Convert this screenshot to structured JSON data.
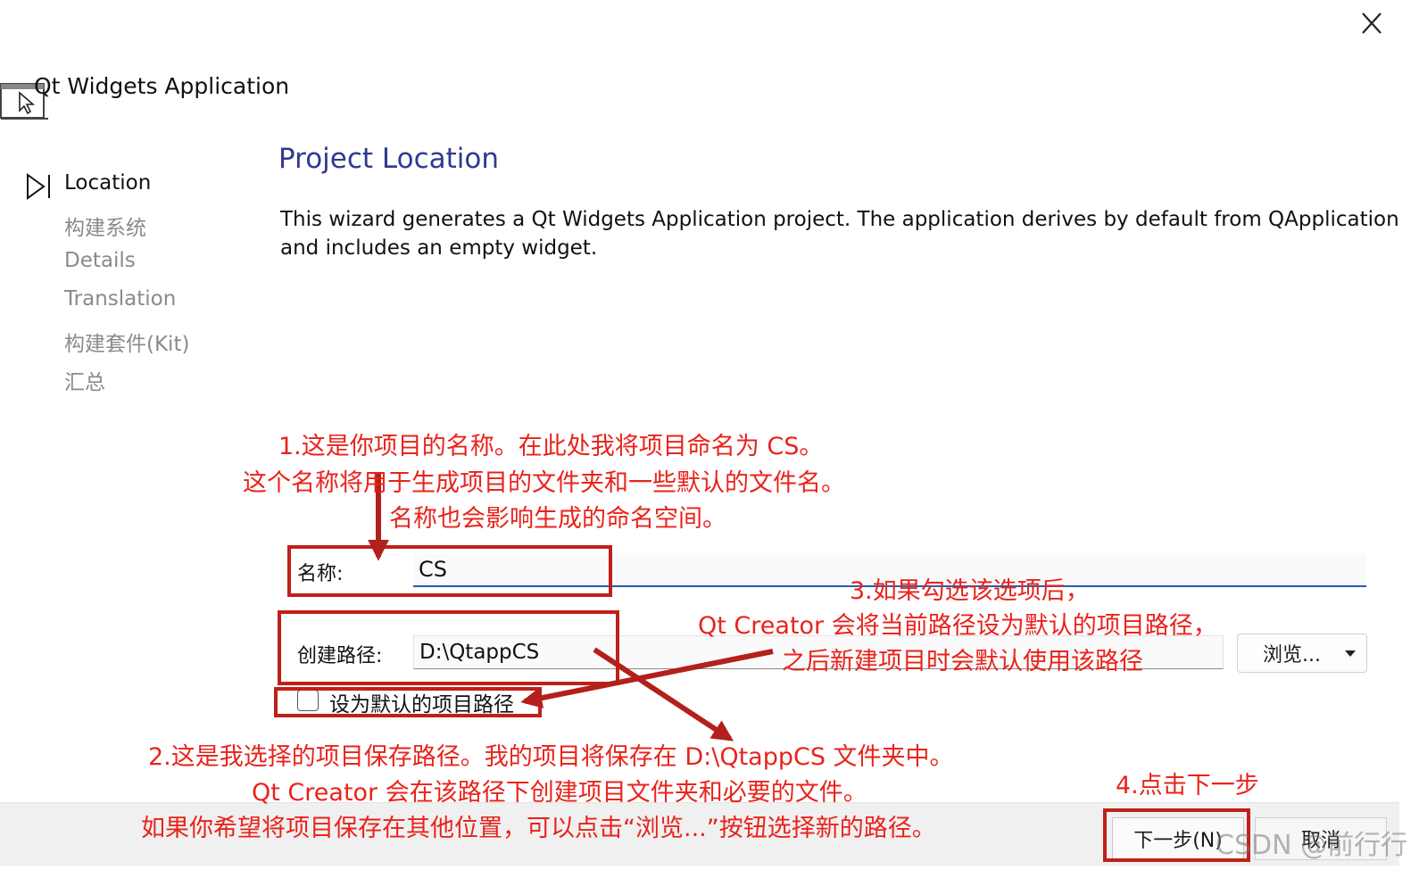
{
  "window": {
    "title": "Qt Widgets Application",
    "close_icon": "close-icon"
  },
  "steps": [
    {
      "label": "Location",
      "active": true
    },
    {
      "label": "构建系统",
      "active": false
    },
    {
      "label": "Details",
      "active": false
    },
    {
      "label": "Translation",
      "active": false
    },
    {
      "label": "构建套件(Kit)",
      "active": false
    },
    {
      "label": "汇总",
      "active": false
    }
  ],
  "page": {
    "title": "Project Location",
    "description": "This wizard generates a Qt Widgets Application project. The application derives by default from QApplication and includes an empty widget."
  },
  "form": {
    "name_label": "名称:",
    "name_value": "CS",
    "path_label": "创建路径:",
    "path_value": "D:\\QtappCS",
    "browse_label": "浏览...",
    "default_path_label": "设为默认的项目路径",
    "default_path_checked": false
  },
  "footer": {
    "next_label": "下一步(N)",
    "cancel_label": "取消"
  },
  "annotations": {
    "note1_line1": "1.这是你项目的名称。在此处我将项目命名为 CS。",
    "note1_line2": "这个名称将用于生成项目的文件夹和一些默认的文件名。",
    "note1_line3": "名称也会影响生成的命名空间。",
    "note2_line1": "2.这是我选择的项目保存路径。我的项目将保存在 D:\\QtappCS 文件夹中。",
    "note2_line2": "Qt Creator 会在该路径下创建项目文件夹和必要的文件。",
    "note2_line3": "如果你希望将项目保存在其他位置，可以点击“浏览...”按钮选择新的路径。",
    "note3_line1": "3.如果勾选该选项后，",
    "note3_line2": "Qt Creator 会将当前路径设为默认的项目路径，",
    "note3_line3": "之后新建项目时会默认使用该路径",
    "note4": "4.点击下一步",
    "color": "#e8231b",
    "box_color": "#c0201a"
  },
  "watermark": "CSDN @前行行"
}
